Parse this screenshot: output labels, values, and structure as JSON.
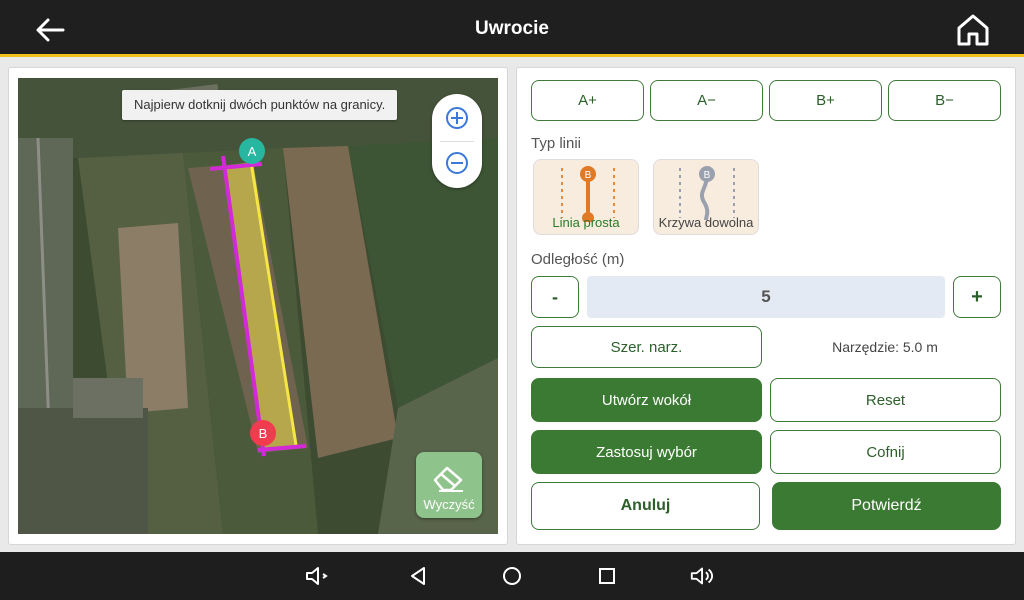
{
  "header": {
    "title": "Uwrocie",
    "back_icon": "arrow-left-icon",
    "home_icon": "home-icon"
  },
  "map": {
    "hint": "Najpierw dotknij dwóch punktów na granicy.",
    "point_a": "A",
    "point_b": "B",
    "zoom_in_icon": "plus-icon",
    "zoom_out_icon": "minus-icon",
    "clear_label": "Wyczyść",
    "clear_icon": "eraser-icon"
  },
  "controls": {
    "shift_buttons": [
      "A+",
      "A−",
      "B+",
      "B−"
    ],
    "line_type_label": "Typ linii",
    "line_types": [
      {
        "label": "Linia prosta",
        "icon": "straight-line-icon",
        "selected": true
      },
      {
        "label": "Krzywa dowolna",
        "icon": "curve-line-icon",
        "selected": false
      }
    ],
    "distance_label": "Odległość (m)",
    "minus_label": "-",
    "plus_label": "+",
    "distance_value": "5",
    "tool_width_button": "Szer. narz.",
    "tool_info": "Narzędzie: 5.0 m",
    "create_around": "Utwórz wokół",
    "reset": "Reset",
    "apply_selection": "Zastosuj wybór",
    "undo": "Cofnij",
    "cancel": "Anuluj",
    "confirm": "Potwierdź"
  },
  "colors": {
    "accent_green": "#3b7a32",
    "header_bg": "#1f1f1f",
    "header_stripe": "#f2c21b",
    "boundary_line": "#d22ad6",
    "guide_line": "#f5e642",
    "point_a": "#27b7a0",
    "point_b": "#f03c4e"
  },
  "navbar": {
    "icons": [
      "volume-down-icon",
      "back-triangle-icon",
      "home-circle-icon",
      "recents-square-icon",
      "volume-up-icon"
    ]
  }
}
